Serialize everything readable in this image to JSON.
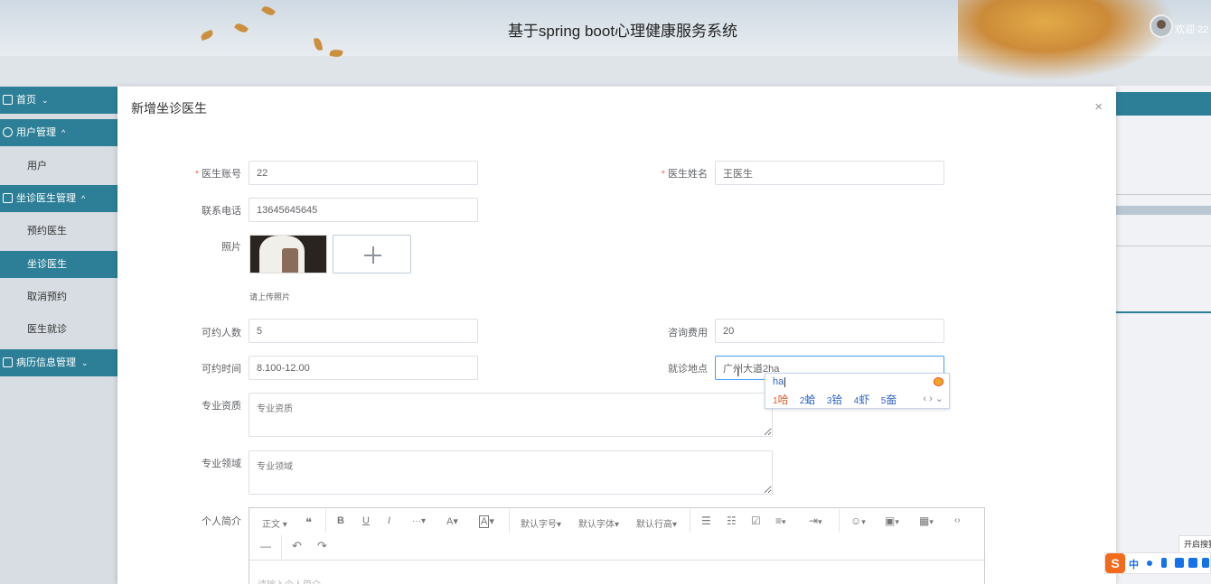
{
  "app": {
    "title": "基于spring boot心理健康服务系统",
    "welcome": "欢迎 22"
  },
  "sidebar": {
    "items": [
      {
        "label": "首页",
        "type": "head",
        "chevron": "⌄"
      },
      {
        "label": "用户管理",
        "type": "head",
        "chevron": "^"
      },
      {
        "label": "用户",
        "type": "sub"
      },
      {
        "label": "坐诊医生管理",
        "type": "head",
        "chevron": "^"
      },
      {
        "label": "预约医生",
        "type": "sub"
      },
      {
        "label": "坐诊医生",
        "type": "sub",
        "active": true
      },
      {
        "label": "取消预约",
        "type": "sub"
      },
      {
        "label": "医生就诊",
        "type": "sub"
      },
      {
        "label": "病历信息管理",
        "type": "head",
        "chevron": "⌄"
      }
    ]
  },
  "dialog": {
    "title": "新增坐诊医生",
    "close": "×",
    "fields": {
      "account": {
        "label": "医生账号",
        "value": "22",
        "required": "*"
      },
      "name": {
        "label": "医生姓名",
        "value": "王医生",
        "required": "*"
      },
      "phone": {
        "label": "联系电话",
        "value": "13645645645"
      },
      "photo": {
        "label": "照片",
        "hint": "请上传照片"
      },
      "capacity": {
        "label": "可约人数",
        "value": "5"
      },
      "fee": {
        "label": "咨询费用",
        "value": "20"
      },
      "time": {
        "label": "可约时间",
        "value": "8.100-12.00"
      },
      "location": {
        "label": "就诊地点",
        "value": "广州大道2ha"
      },
      "qualification": {
        "label": "专业资质",
        "placeholder": "专业资质"
      },
      "field": {
        "label": "专业领域",
        "placeholder": "专业领域"
      },
      "intro": {
        "label": "个人简介",
        "placeholder": "请输入个人简介"
      }
    }
  },
  "editor_toolbar": {
    "paragraph": "正文",
    "font_size": "默认字号",
    "font_family": "默认字体",
    "line_height": "默认行高",
    "quote": "❝",
    "bold": "B",
    "underline": "U",
    "italic": "I",
    "more": "···",
    "font_color": "A",
    "bg_color": "A",
    "bullet_list": "☰",
    "numbered_list": "☷",
    "todo": "☑",
    "align": "≡",
    "indent": "⇥",
    "emoji": "☺",
    "image": "▣",
    "table": "▦",
    "code": "‹›",
    "divider": "—",
    "undo": "↶",
    "redo": "↷",
    "caret": "▾"
  },
  "ime_popup": {
    "composition": "ha",
    "candidates": [
      {
        "num": "1",
        "char": "哈"
      },
      {
        "num": "2",
        "char": "蛤"
      },
      {
        "num": "3",
        "char": "铪"
      },
      {
        "num": "4",
        "char": "虾"
      },
      {
        "num": "5",
        "char": "奤"
      }
    ],
    "nav": "‹ › ⌄"
  },
  "taskbar_ime": {
    "logo": "S",
    "lang": "中",
    "tooltip": "开启搜狗"
  },
  "colors": {
    "accent": "#2d7f97",
    "required": "#f56c6c"
  }
}
